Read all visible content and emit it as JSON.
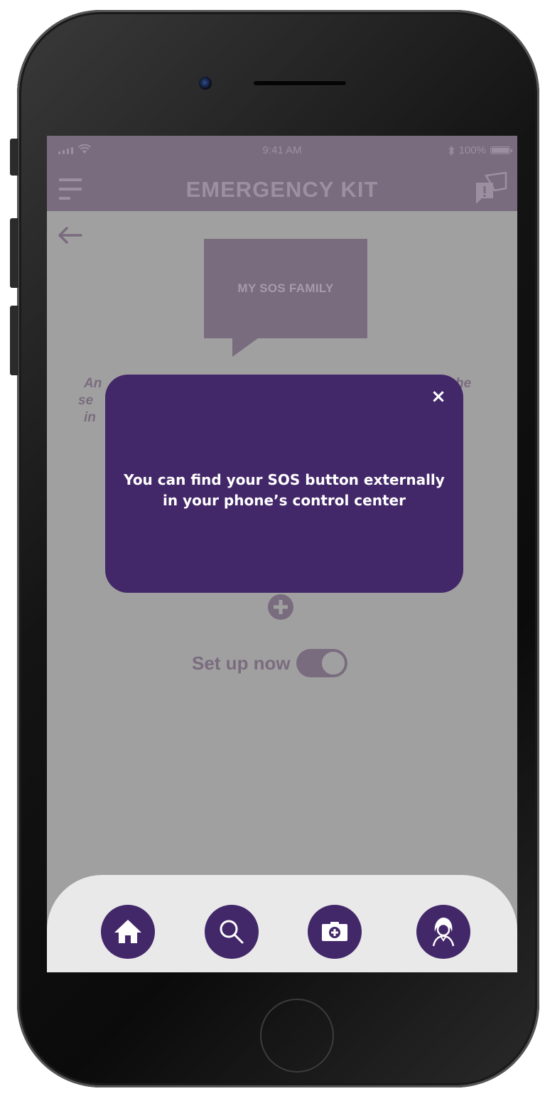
{
  "status_bar": {
    "time": "9:41 AM",
    "battery": "100%"
  },
  "header": {
    "title": "EMERGENCY KIT"
  },
  "content": {
    "bubble_text": "MY SOS FAMILY",
    "bg_fragments": [
      "An",
      "se",
      "in",
      "he"
    ],
    "setup_label": "Set up now",
    "toggle_on": true
  },
  "popup": {
    "close_glyph": "×",
    "message": "You can find your SOS button externally in your phone’s control center"
  },
  "tab_bar": {
    "items": [
      {
        "name": "home",
        "icon": "home-icon"
      },
      {
        "name": "search",
        "icon": "search-icon"
      },
      {
        "name": "emergency-kit",
        "icon": "medical-kit-icon"
      },
      {
        "name": "profile",
        "icon": "user-icon"
      }
    ]
  },
  "colors": {
    "primary_purple": "#432869",
    "header_muted": "#7a6c7f",
    "overlay_gray": "#a1a0a0",
    "tab_bar_bg": "#e9e9e9"
  }
}
